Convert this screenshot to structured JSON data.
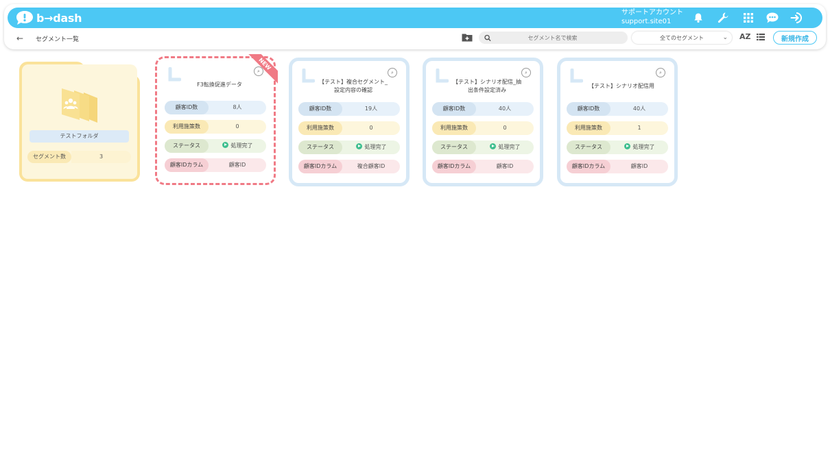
{
  "app": {
    "logo_text": "b→dash"
  },
  "header": {
    "account_label": "サポートアカウント",
    "account_site": "support.site01",
    "icons": [
      "bell-icon",
      "wrench-icon",
      "grid-icon",
      "chat-icon",
      "logout-icon"
    ]
  },
  "toolbar": {
    "breadcrumb": "セグメント一覧",
    "search_placeholder": "セグメント名で検索",
    "filter_selected": "全てのセグメント",
    "sort_label": "AZ",
    "new_button": "新規作成"
  },
  "folder": {
    "name": "テストフォルダ",
    "count_label": "セグメント数",
    "count_value": "3"
  },
  "labels": {
    "id_count": "顧客ID数",
    "usage": "利用施策数",
    "status": "ステータス",
    "id_column": "顧客IDカラム",
    "new_badge": "NEW"
  },
  "segments": [
    {
      "title": "F3転換促進データ",
      "title2": "",
      "id_count": "8人",
      "usage": "0",
      "status": "処理完了",
      "id_column": "顧客ID",
      "is_new": true
    },
    {
      "title": "【テスト】複合セグメント_",
      "title2": "設定内容の確認",
      "id_count": "19人",
      "usage": "0",
      "status": "処理完了",
      "id_column": "複合顧客ID",
      "is_new": false
    },
    {
      "title": "【テスト】シナリオ配信_抽",
      "title2": "出条件設定済み",
      "id_count": "40人",
      "usage": "0",
      "status": "処理完了",
      "id_column": "顧客ID",
      "is_new": false
    },
    {
      "title": "【テスト】シナリオ配信用",
      "title2": "",
      "id_count": "40人",
      "usage": "1",
      "status": "処理完了",
      "id_column": "顧客ID",
      "is_new": false
    }
  ],
  "colors": {
    "accent": "#4cc8f4",
    "new": "#f07a85",
    "folder": "#fae29a"
  }
}
